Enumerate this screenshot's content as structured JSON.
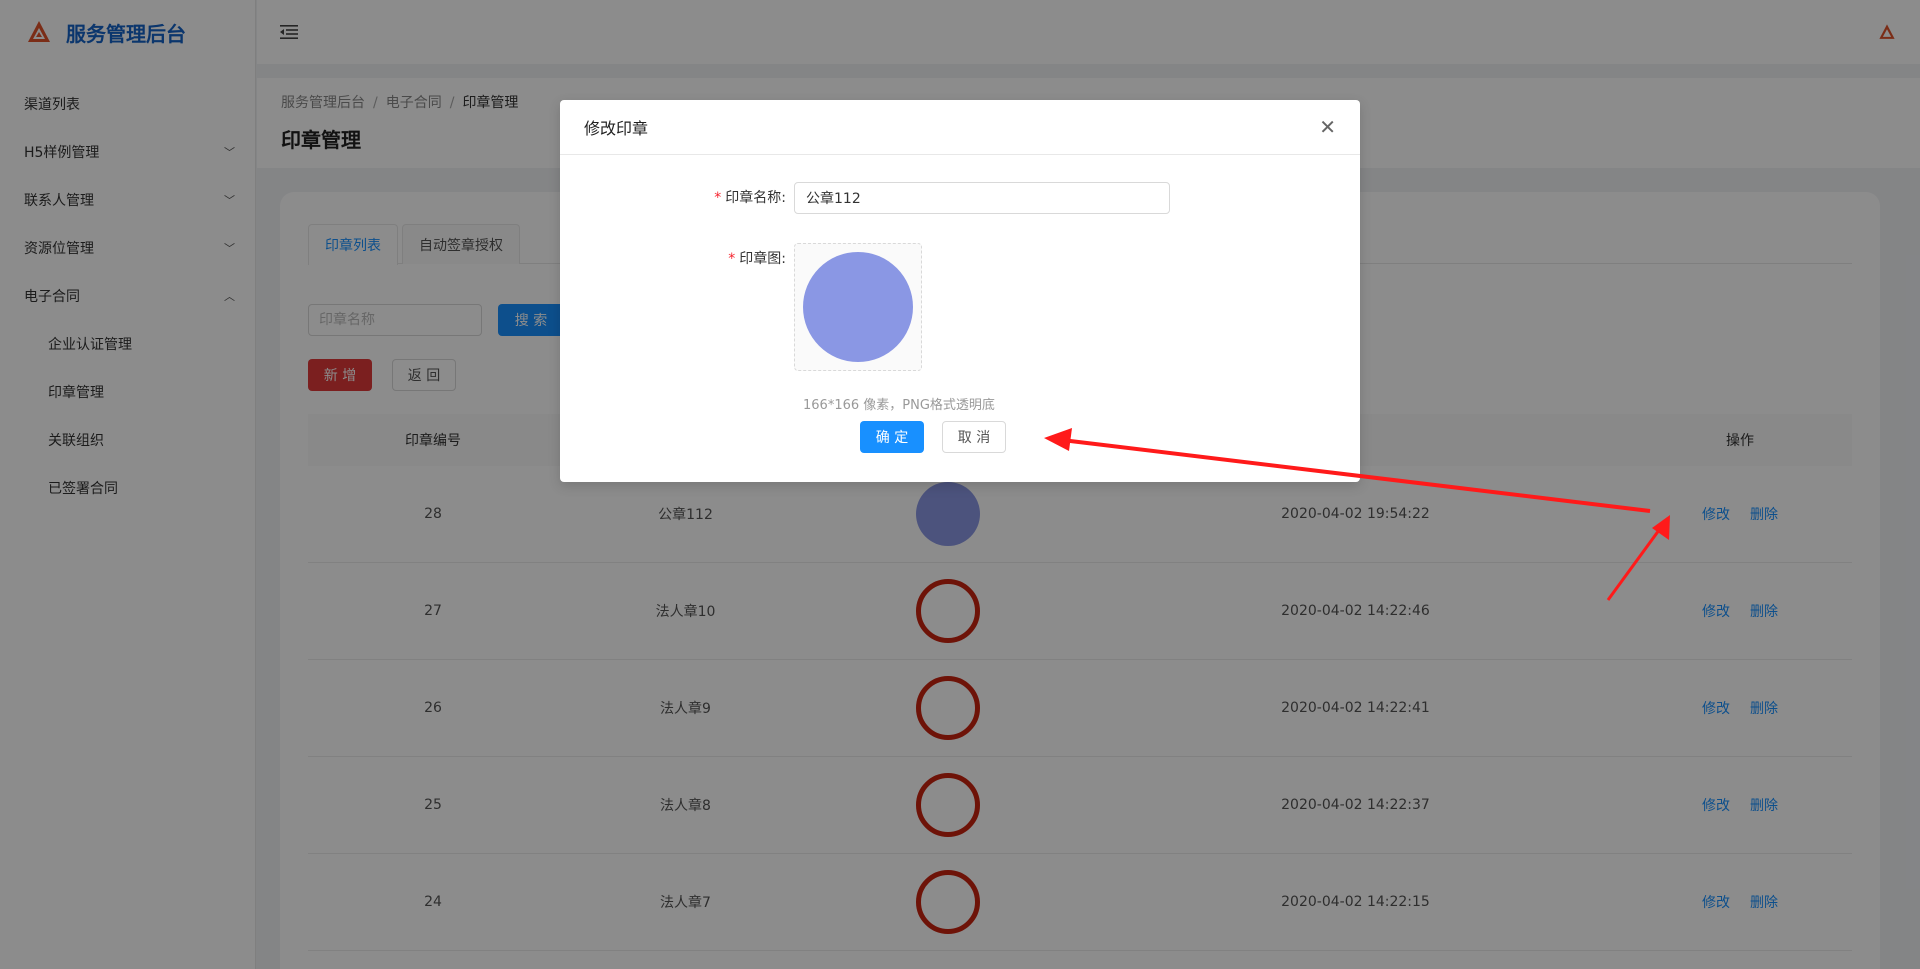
{
  "app": {
    "title": "服务管理后台",
    "accent": "#1563c6",
    "logo_color": "#e0532b"
  },
  "sidebar": {
    "items": [
      {
        "label": "渠道列表",
        "chevron": ""
      },
      {
        "label": "H5样例管理",
        "chevron": "chevron-down-icon"
      },
      {
        "label": "联系人管理",
        "chevron": "chevron-down-icon"
      },
      {
        "label": "资源位管理",
        "chevron": "chevron-down-icon"
      },
      {
        "label": "电子合同",
        "chevron": "chevron-up-icon"
      },
      {
        "label": "企业认证管理",
        "sub": true
      },
      {
        "label": "印章管理",
        "sub": true
      },
      {
        "label": "关联组织",
        "sub": true
      },
      {
        "label": "已签署合同",
        "sub": true
      }
    ]
  },
  "breadcrumb": [
    "服务管理后台",
    "电子合同",
    "印章管理"
  ],
  "page_title": "印章管理",
  "tabs": [
    "印章列表",
    "自动签章授权"
  ],
  "search": {
    "placeholder": "印章名称",
    "button": "搜 索"
  },
  "actions": {
    "add": "新 增",
    "back": "返 回"
  },
  "table": {
    "headers": [
      "印章编号",
      "",
      "",
      "",
      "操作"
    ],
    "rows": [
      {
        "id": "28",
        "name": "公章112",
        "seal": "filled",
        "time": "2020-04-02 19:54:22"
      },
      {
        "id": "27",
        "name": "法人章10",
        "seal": "ring",
        "time": "2020-04-02 14:22:46"
      },
      {
        "id": "26",
        "name": "法人章9",
        "seal": "ring",
        "time": "2020-04-02 14:22:41"
      },
      {
        "id": "25",
        "name": "法人章8",
        "seal": "ring",
        "time": "2020-04-02 14:22:37"
      },
      {
        "id": "24",
        "name": "法人章7",
        "seal": "ring",
        "time": "2020-04-02 14:22:15"
      }
    ],
    "edit_label": "修改",
    "delete_label": "删除"
  },
  "modal": {
    "title": "修改印章",
    "name_label": "印章名称:",
    "name_value": "公章112",
    "image_label": "印章图:",
    "hint": "166*166 像素，PNG格式透明底",
    "ok": "确 定",
    "cancel": "取 消"
  },
  "colors": {
    "primary": "#1890ff",
    "danger": "#e03a3a",
    "seal_filled": "#8a97e4",
    "seal_ring": "#c8230f",
    "annotation": "#ff1a1a"
  }
}
